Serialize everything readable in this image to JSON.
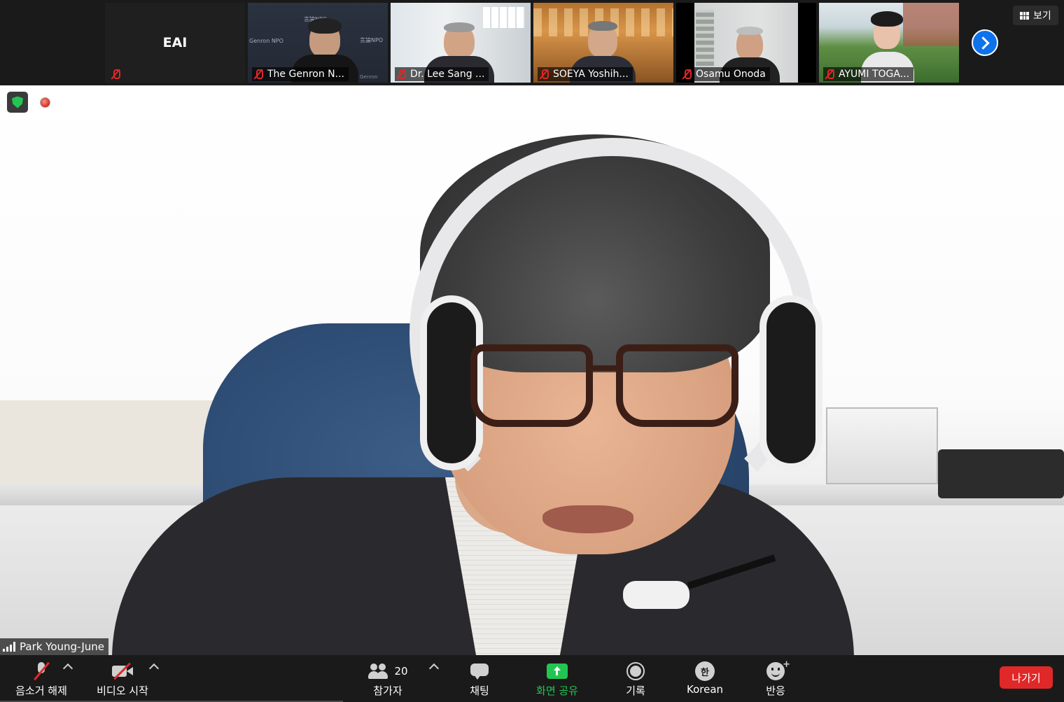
{
  "gallery": {
    "tiles": [
      {
        "name": "EAI",
        "type": "avatar"
      },
      {
        "name": "The Genron N..."
      },
      {
        "name": "Dr. Lee Sang ..."
      },
      {
        "name": "SOEYA Yoshih..."
      },
      {
        "name": "Osamu Onoda"
      },
      {
        "name": "AYUMI TOGA..."
      }
    ],
    "genron_sign_1": "言論NPO",
    "genron_sign_2": "Genron NPO",
    "genron_sign_3": "言論NPO",
    "genron_sign_4": "Genron",
    "view_label": "보기"
  },
  "main": {
    "speaker_name": "Park Young-June"
  },
  "toolbar": {
    "unmute_label": "음소거 해제",
    "video_label": "비디오 시작",
    "participants_label": "참가자",
    "participants_count": "20",
    "chat_label": "채팅",
    "share_label": "화면 공유",
    "record_label": "기록",
    "language_glyph": "한",
    "language_label": "Korean",
    "reactions_label": "반응",
    "leave_label": "나가기"
  },
  "colors": {
    "accent_blue": "#0e72ed",
    "share_green": "#23c552",
    "leave_red": "#e02828",
    "muted_red": "#e02828",
    "toolbar_bg": "#1a1a1a"
  }
}
